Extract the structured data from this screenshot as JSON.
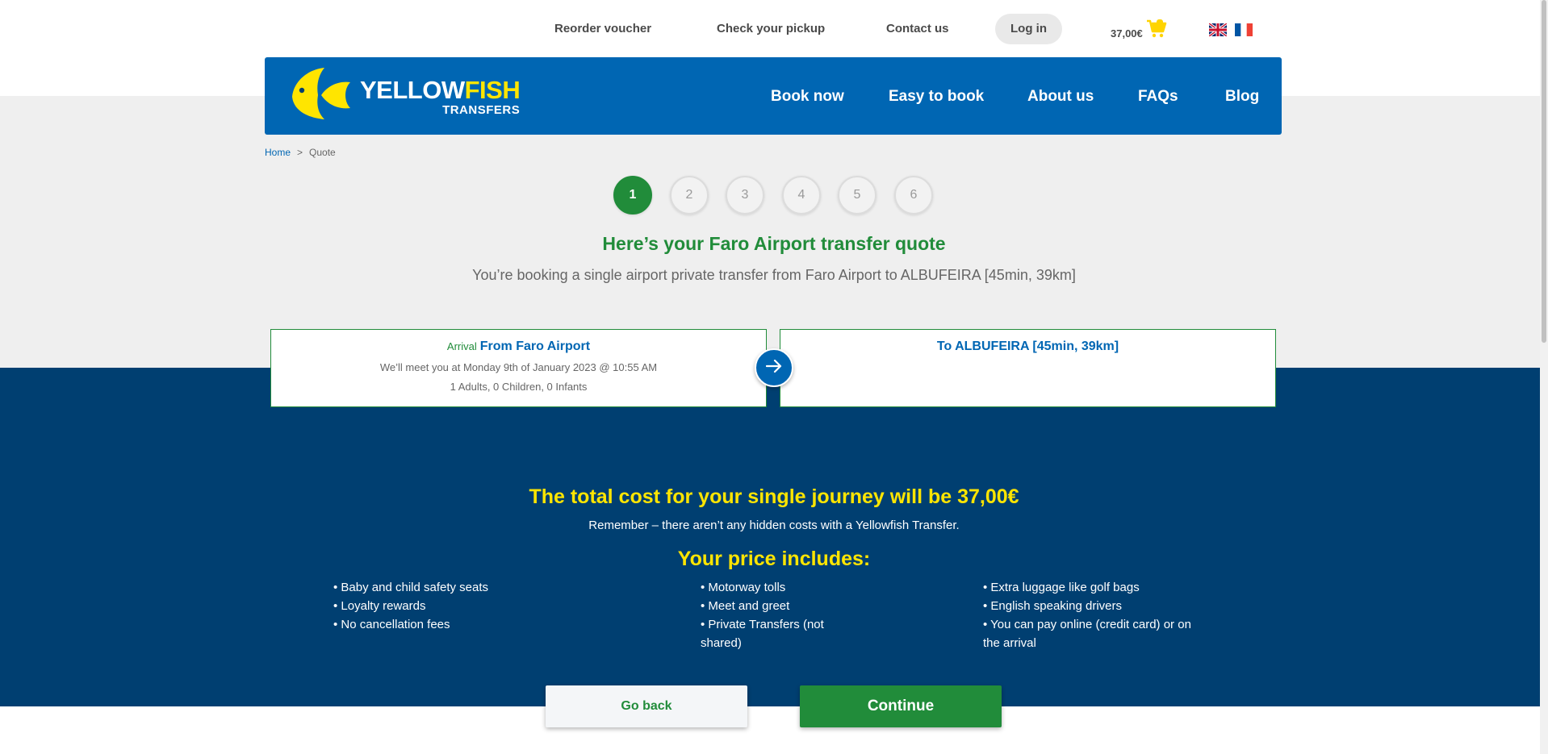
{
  "topbar": {
    "reorder_voucher": "Reorder voucher",
    "check_pickup": "Check your pickup",
    "contact_us": "Contact us",
    "login": "Log in",
    "cart_amount": "37,00€",
    "cart_icon": "shopping-cart-icon",
    "languages": [
      "en-flag-icon",
      "fr-flag-icon"
    ]
  },
  "header": {
    "logo_brand_white": "YELLOW",
    "logo_brand_yellow": "FISH",
    "logo_sub": "TRANSFERS",
    "nav": [
      "Book now",
      "Easy to book",
      "About us",
      "FAQs",
      "Blog"
    ]
  },
  "breadcrumb": {
    "home": "Home",
    "separator": ">",
    "current": "Quote"
  },
  "steps": [
    "1",
    "2",
    "3",
    "4",
    "5",
    "6"
  ],
  "active_step": "1",
  "quote": {
    "title": "Here’s your Faro Airport transfer quote",
    "subtitle": "You’re booking a single airport private transfer from Faro Airport to ALBUFEIRA [45min, 39km]"
  },
  "journey": {
    "from_label": "Arrival",
    "from_title": "From Faro Airport",
    "from_meet": "We’ll meet you at Monday 9th of January 2023 @ 10:55 AM",
    "from_pax": "1 Adults, 0 Children, 0 Infants",
    "to_title": "To ALBUFEIRA [45min, 39km]"
  },
  "pricing": {
    "total": "The total cost for your single journey will be 37,00€",
    "remember": "Remember – there aren’t any hidden costs with a Yellowfish Transfer.",
    "includes_title": "Your price includes:",
    "col1": [
      "• Baby and child safety seats",
      "• Loyalty rewards",
      "• No cancellation fees"
    ],
    "col2": [
      "• Motorway tolls",
      "• Meet and greet",
      "• Private Transfers (not",
      "shared)"
    ],
    "col3": [
      "• Extra luggage like golf bags",
      "• English speaking drivers",
      "• You can pay online (credit card) or on",
      "the arrival"
    ]
  },
  "buttons": {
    "back": "Go back",
    "continue": "Continue"
  },
  "colors": {
    "brand_blue": "#0066b3",
    "dark_blue": "#003f71",
    "green": "#218c3a",
    "yellow": "#ffe500"
  }
}
